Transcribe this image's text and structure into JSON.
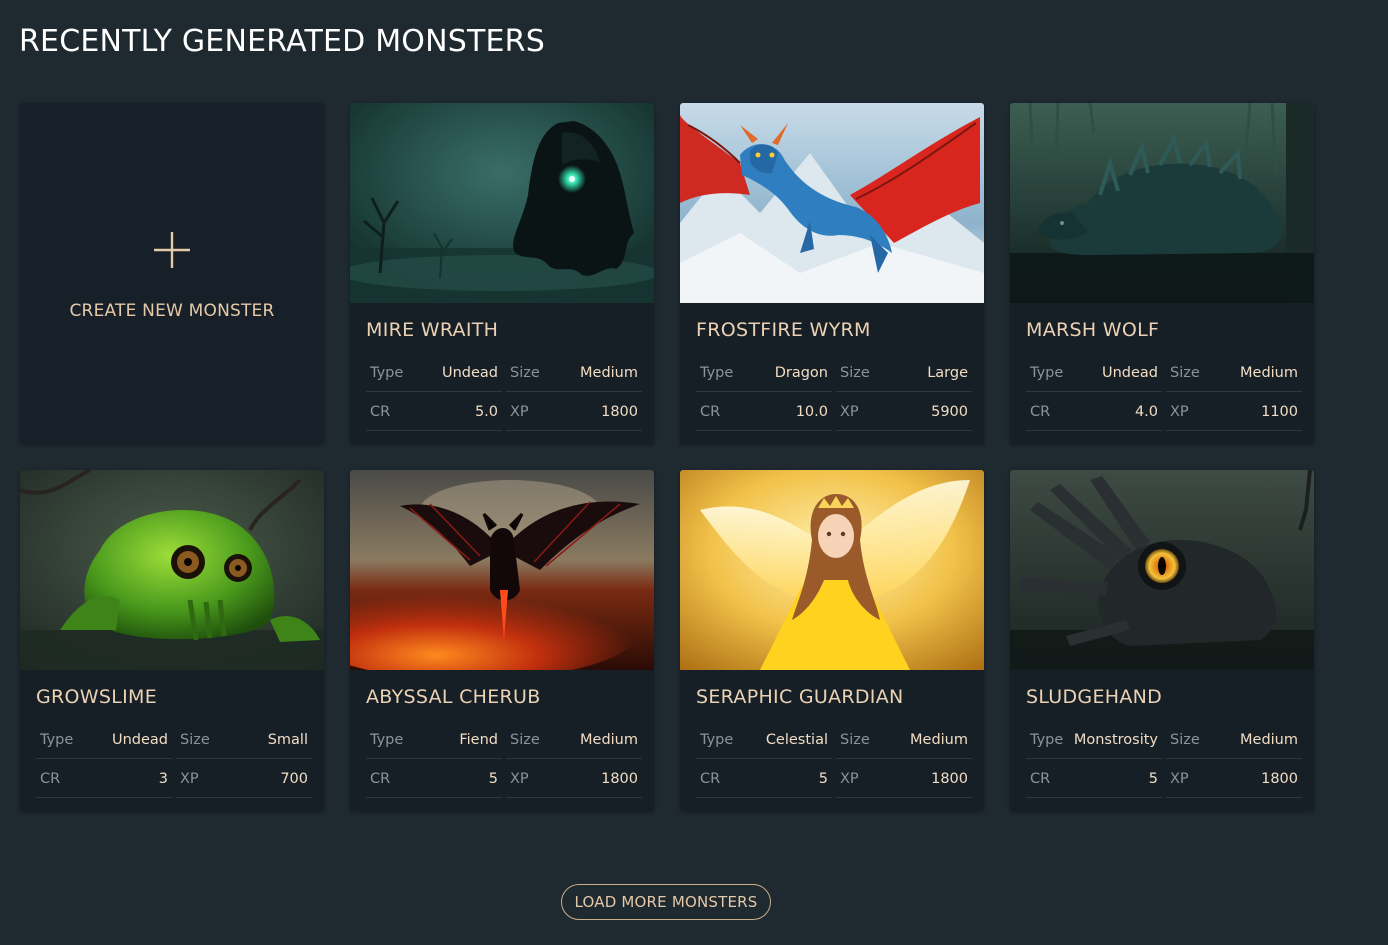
{
  "page": {
    "title": "RECENTLY GENERATED MONSTERS"
  },
  "create_card": {
    "icon": "plus-icon",
    "label": "CREATE NEW MONSTER"
  },
  "stat_labels": {
    "type": "Type",
    "size": "Size",
    "cr": "CR",
    "xp": "XP"
  },
  "monsters": [
    {
      "name": "MIRE WRAITH",
      "type": "Undead",
      "size": "Medium",
      "cr": "5.0",
      "xp": "1800",
      "image": "mire-wraith-image"
    },
    {
      "name": "FROSTFIRE WYRM",
      "type": "Dragon",
      "size": "Large",
      "cr": "10.0",
      "xp": "5900",
      "image": "frostfire-wyrm-image"
    },
    {
      "name": "MARSH WOLF",
      "type": "Undead",
      "size": "Medium",
      "cr": "4.0",
      "xp": "1100",
      "image": "marsh-wolf-image"
    },
    {
      "name": "GROWSLIME",
      "type": "Undead",
      "size": "Small",
      "cr": "3",
      "xp": "700",
      "image": "growslime-image"
    },
    {
      "name": "ABYSSAL CHERUB",
      "type": "Fiend",
      "size": "Medium",
      "cr": "5",
      "xp": "1800",
      "image": "abyssal-cherub-image"
    },
    {
      "name": "SERAPHIC GUARDIAN",
      "type": "Celestial",
      "size": "Medium",
      "cr": "5",
      "xp": "1800",
      "image": "seraphic-guardian-image"
    },
    {
      "name": "SLUDGEHAND",
      "type": "Monstrosity",
      "size": "Medium",
      "cr": "5",
      "xp": "1800",
      "image": "sludgehand-image"
    }
  ],
  "load_more": {
    "label": "LOAD MORE MONSTERS"
  },
  "colors": {
    "background": "#1e2930",
    "card": "#161f26",
    "accent": "#ecd2b4",
    "label": "#8d939a"
  }
}
